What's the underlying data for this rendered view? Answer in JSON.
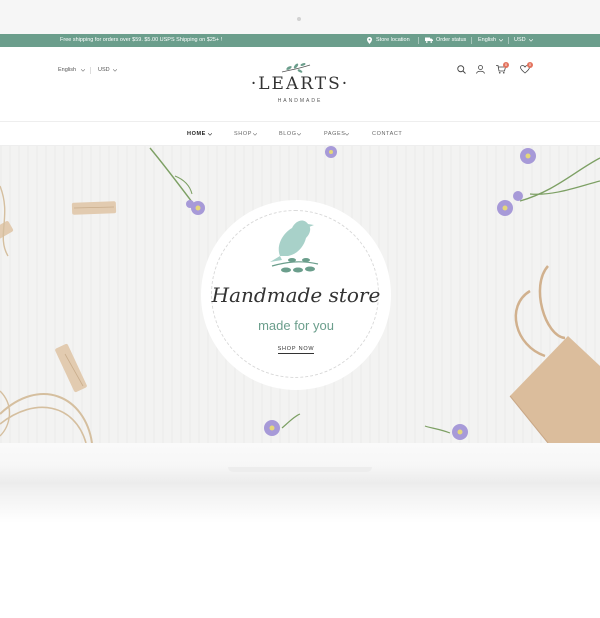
{
  "topbar": {
    "promo": "Free shipping for orders over $59. $5.00 USPS Shipping on $25+ !",
    "store_location": "Store location",
    "order_status": "Order status",
    "language": "English",
    "currency": "USD"
  },
  "header": {
    "language": "English",
    "currency": "USD",
    "logo_title": "·LEARTS·",
    "logo_subtitle": "HANDMADE",
    "cart_count": "0",
    "wishlist_count": "0"
  },
  "nav": {
    "items": [
      "HOME",
      "SHOP",
      "BLOG",
      "PAGES",
      "CONTACT"
    ]
  },
  "hero": {
    "title": "Handmade store",
    "subtitle": "made for you",
    "cta": "SHOP NOW"
  },
  "colors": {
    "brand": "#6b9e8c",
    "badge": "#e3735e"
  },
  "icons": [
    "map-pin-icon",
    "truck-icon",
    "chevron-down-icon",
    "search-icon",
    "user-icon",
    "cart-icon",
    "heart-icon",
    "bird-icon"
  ]
}
